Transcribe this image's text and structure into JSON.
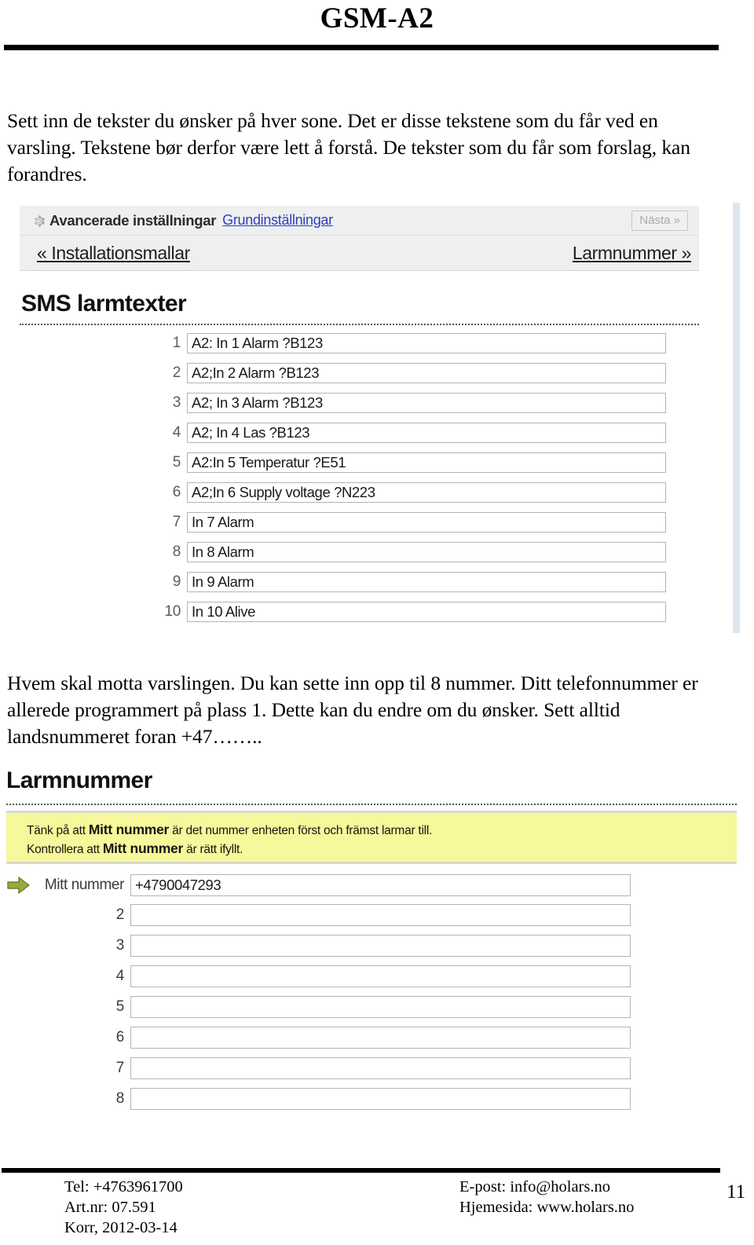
{
  "document": {
    "title": "GSM-A2",
    "page_number": "11",
    "paragraph_top": "Sett inn de tekster du ønsker på hver sone. Det er disse tekstene som du får ved en varsling. Tekstene bør derfor være lett å forstå. De tekster som du får som forslag, kan forandres.",
    "paragraph_middle": "Hvem skal motta varslingen. Du kan sette inn opp til 8 nummer. Ditt telefonnummer er allerede programmert på plass 1. Dette kan du endre om du ønsker. Sett alltid landsnummeret foran +47…….."
  },
  "sms_screenshot": {
    "nav": {
      "gear_icon": "gear-icon",
      "advanced_label": "Avancerade inställningar",
      "basic_link": "Grundinställningar",
      "next_button": "Nästa »",
      "prev_link": "« Installationsmallar",
      "next_link": "Larmnummer »"
    },
    "heading": "SMS larmtexter",
    "rows": [
      {
        "num": "1",
        "value": "A2: In 1 Alarm ?B123"
      },
      {
        "num": "2",
        "value": "A2;In 2 Alarm ?B123"
      },
      {
        "num": "3",
        "value": "A2; In 3 Alarm ?B123"
      },
      {
        "num": "4",
        "value": "A2; In 4 Las ?B123"
      },
      {
        "num": "5",
        "value": "A2:In 5 Temperatur  ?E51"
      },
      {
        "num": "6",
        "value": "A2;In 6 Supply voltage ?N223"
      },
      {
        "num": "7",
        "value": "In 7 Alarm"
      },
      {
        "num": "8",
        "value": "In 8 Alarm"
      },
      {
        "num": "9",
        "value": "In 9 Alarm"
      },
      {
        "num": "10",
        "value": "In 10 Alive"
      }
    ]
  },
  "larm_screenshot": {
    "heading": "Larmnummer",
    "note": {
      "line1_pre": "Tänk på att ",
      "line1_bold": "Mitt nummer",
      "line1_post": " är det nummer enheten först och främst larmar till.",
      "line2_pre": "Kontrollera att ",
      "line2_bold": "Mitt nummer",
      "line2_post": " är rätt ifyllt."
    },
    "arrow_icon": "arrow-right-icon",
    "rows": [
      {
        "num": "Mitt nummer",
        "value": "+4790047293"
      },
      {
        "num": "2",
        "value": ""
      },
      {
        "num": "3",
        "value": ""
      },
      {
        "num": "4",
        "value": ""
      },
      {
        "num": "5",
        "value": ""
      },
      {
        "num": "6",
        "value": ""
      },
      {
        "num": "7",
        "value": ""
      },
      {
        "num": "8",
        "value": ""
      }
    ]
  },
  "footer": {
    "left": [
      "Tel:  +4763961700",
      "Art.nr: 07.591",
      "Korr, 2012-03-14"
    ],
    "right": [
      "E-post: info@holars.no",
      "Hjemesida: www.holars.no"
    ]
  },
  "colors": {
    "note_background": "#f7f79b",
    "link_blue": "#2b3fbd",
    "nav_background": "#efefef",
    "scroll_strip": "#dce6ee",
    "arrow_green": "#8a9b38"
  }
}
